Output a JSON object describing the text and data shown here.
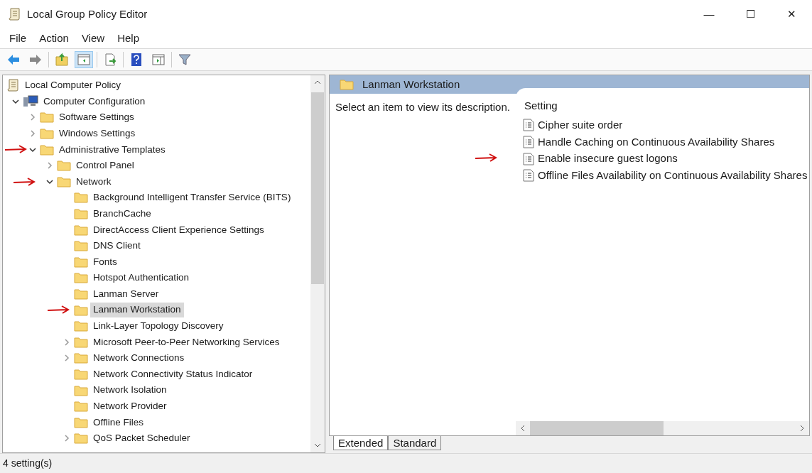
{
  "window": {
    "title": "Local Group Policy Editor",
    "controls": [
      "—",
      "☐",
      "✕"
    ]
  },
  "menu": [
    "File",
    "Action",
    "View",
    "Help"
  ],
  "toolbar": [
    {
      "kind": "back",
      "selected": false
    },
    {
      "kind": "forward",
      "selected": false
    },
    {
      "kind": "up",
      "selected": false
    },
    {
      "kind": "tree",
      "selected": true
    },
    {
      "kind": "export",
      "selected": false
    },
    {
      "kind": "help",
      "selected": false
    },
    {
      "kind": "panel",
      "selected": false
    },
    {
      "kind": "filter",
      "selected": false
    }
  ],
  "tree": [
    {
      "label": "Local Computer Policy",
      "kind": "policy",
      "selected": false,
      "marked": false,
      "children": [
        {
          "label": "Computer Configuration",
          "kind": "computer",
          "expanded": true,
          "selected": false,
          "marked": false,
          "children": [
            {
              "label": "Software Settings",
              "kind": "branch",
              "expanded": false,
              "selected": false,
              "marked": false
            },
            {
              "label": "Windows Settings",
              "kind": "branch",
              "expanded": false,
              "selected": false,
              "marked": false
            },
            {
              "label": "Administrative Templates",
              "kind": "branch",
              "expanded": true,
              "selected": false,
              "marked": true,
              "children": [
                {
                  "label": "Control Panel",
                  "kind": "branch",
                  "expanded": false,
                  "selected": false,
                  "marked": false
                },
                {
                  "label": "Network",
                  "kind": "branch",
                  "expanded": true,
                  "selected": false,
                  "marked": true,
                  "children": [
                    {
                      "label": "Background Intelligent Transfer Service (BITS)",
                      "kind": "leaf",
                      "selected": false,
                      "marked": false
                    },
                    {
                      "label": "BranchCache",
                      "kind": "leaf",
                      "selected": false,
                      "marked": false
                    },
                    {
                      "label": "DirectAccess Client Experience Settings",
                      "kind": "leaf",
                      "selected": false,
                      "marked": false
                    },
                    {
                      "label": "DNS Client",
                      "kind": "leaf",
                      "selected": false,
                      "marked": false
                    },
                    {
                      "label": "Fonts",
                      "kind": "leaf",
                      "selected": false,
                      "marked": false
                    },
                    {
                      "label": "Hotspot Authentication",
                      "kind": "leaf",
                      "selected": false,
                      "marked": false
                    },
                    {
                      "label": "Lanman Server",
                      "kind": "leaf",
                      "selected": false,
                      "marked": false
                    },
                    {
                      "label": "Lanman Workstation",
                      "kind": "leaf",
                      "selected": true,
                      "marked": true
                    },
                    {
                      "label": "Link-Layer Topology Discovery",
                      "kind": "leaf",
                      "selected": false,
                      "marked": false
                    },
                    {
                      "label": "Microsoft Peer-to-Peer Networking Services",
                      "kind": "branch",
                      "expanded": false,
                      "selected": false,
                      "marked": false
                    },
                    {
                      "label": "Network Connections",
                      "kind": "branch",
                      "expanded": false,
                      "selected": false,
                      "marked": false
                    },
                    {
                      "label": "Network Connectivity Status Indicator",
                      "kind": "leaf",
                      "selected": false,
                      "marked": false
                    },
                    {
                      "label": "Network Isolation",
                      "kind": "leaf",
                      "selected": false,
                      "marked": false
                    },
                    {
                      "label": "Network Provider",
                      "kind": "leaf",
                      "selected": false,
                      "marked": false
                    },
                    {
                      "label": "Offline Files",
                      "kind": "leaf",
                      "selected": false,
                      "marked": false
                    },
                    {
                      "label": "QoS Packet Scheduler",
                      "kind": "branch",
                      "expanded": false,
                      "selected": false,
                      "marked": false
                    }
                  ]
                }
              ]
            }
          ]
        }
      ]
    }
  ],
  "details": {
    "header": "Lanman Workstation",
    "description": "Select an item to view its description.",
    "column": "Setting",
    "settings": [
      {
        "label": "Cipher suite order",
        "marked": false
      },
      {
        "label": "Handle Caching on Continuous Availability Shares",
        "marked": false
      },
      {
        "label": "Enable insecure guest logons",
        "marked": true
      },
      {
        "label": "Offline Files Availability on Continuous Availability Shares",
        "marked": false
      }
    ],
    "tabs": [
      {
        "label": "Extended",
        "selected": true
      },
      {
        "label": "Standard",
        "selected": false
      }
    ]
  },
  "status_bar": "4 setting(s)"
}
